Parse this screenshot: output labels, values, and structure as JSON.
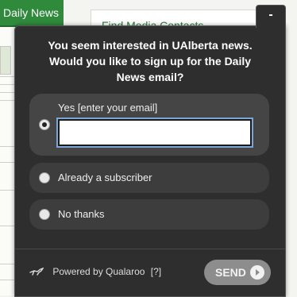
{
  "background": {
    "tab_label": "Daily News",
    "link_text": "Find Media Contacts"
  },
  "widget": {
    "minimize_label": "-",
    "question_lines": [
      "You seem interested in UAlberta news.",
      "Would you like to sign up for the Daily",
      "News email?"
    ],
    "options": [
      {
        "label": "Yes [enter your email]",
        "selected": true
      },
      {
        "label": "Already a subscriber",
        "selected": false
      },
      {
        "label": "No thanks",
        "selected": false
      }
    ],
    "email": {
      "value": "",
      "placeholder": ""
    },
    "powered_by": "Powered by Qualaroo",
    "help_link": "[?]",
    "send_label": "SEND"
  }
}
